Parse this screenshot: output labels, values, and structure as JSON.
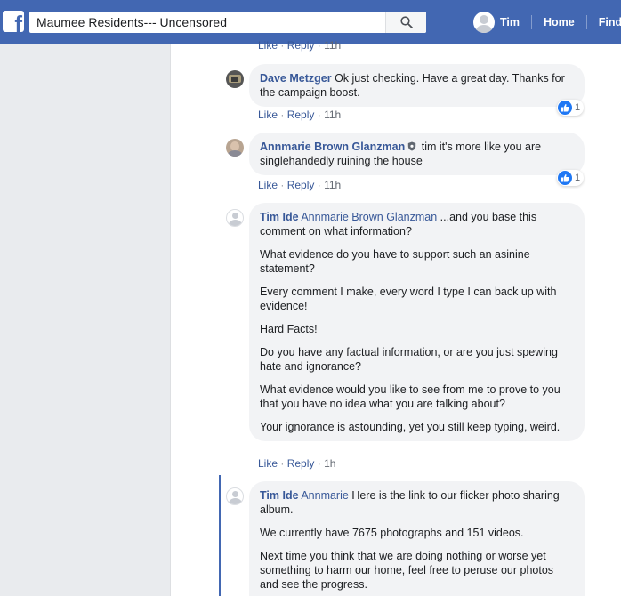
{
  "header": {
    "search_value": "Maumee Residents--- Uncensored",
    "user_name": "Tim",
    "nav_home": "Home",
    "nav_find": "Find"
  },
  "comments": [
    {
      "meta": {
        "like": "Like",
        "reply": "Reply",
        "time": "11h"
      }
    },
    {
      "author": "Dave Metzger",
      "text": "Ok just checking. Have a great day. Thanks for the campaign boost.",
      "reaction_count": "1",
      "meta": {
        "like": "Like",
        "reply": "Reply",
        "time": "11h"
      }
    },
    {
      "author": "Annmarie Brown Glanzman",
      "text": "tim it's more like you are singlehandedly ruining the house",
      "reaction_count": "1",
      "meta": {
        "like": "Like",
        "reply": "Reply",
        "time": "11h"
      }
    },
    {
      "author": "Tim Ide",
      "tag": "Annmarie Brown Glanzman",
      "paragraphs": [
        "...and you base this comment on what information?",
        "What evidence do you have to support such an asinine statement?",
        "Every comment I make, every word I type I can back up with evidence!",
        "Hard Facts!",
        "Do you have any factual information, or are you just spewing hate and ignorance?",
        "What evidence would you like to see from me to prove to you that you have no idea what you are talking about?",
        "Your ignorance is astounding, yet you still keep typing, weird."
      ],
      "meta": {
        "like": "Like",
        "reply": "Reply",
        "time": "1h"
      }
    },
    {
      "author": "Tim Ide",
      "tag": "Annmarie",
      "paragraphs": [
        "Here is the link to our flicker photo sharing album.",
        "We currently have 7675 photographs and 151 videos.",
        "Next time you think that we are doing nothing or worse yet something to harm our home, feel free to peruse our photos and see the progress."
      ]
    }
  ],
  "colors": {
    "header_bg": "#4267b2",
    "link": "#385898",
    "bubble_bg": "#f2f3f5",
    "like_blue": "#2078f4"
  }
}
